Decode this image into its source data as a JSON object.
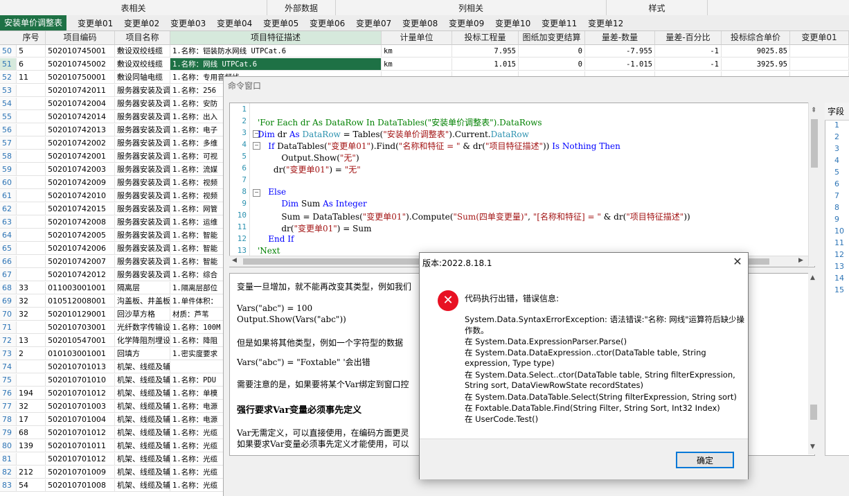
{
  "ribbon_groups": [
    "表相关",
    "外部数据",
    "列相关",
    "样式"
  ],
  "tabs": [
    "安装单价调整表",
    "变更单01",
    "变更单02",
    "变更单03",
    "变更单04",
    "变更单05",
    "变更单06",
    "变更单07",
    "变更单08",
    "变更单09",
    "变更单10",
    "变更单11",
    "变更单12"
  ],
  "columns": [
    "序号",
    "项目编码",
    "项目名称",
    "项目特征描述",
    "计量单位",
    "投标工程量",
    "图纸加变更结算",
    "量差-数量",
    "量差-百分比",
    "投标综合单价",
    "变更单01"
  ],
  "rows": [
    {
      "rn": "50",
      "seq": "5",
      "code": "502010745001",
      "name": "敷设双绞线缆",
      "desc": "1.名称：铠装防水网线 UTPCat.6",
      "unit": "km",
      "qty": "7.955",
      "settle": "0",
      "diff": "-7.955",
      "pct": "-1",
      "price": "9025.85"
    },
    {
      "rn": "51",
      "seq": "6",
      "code": "502010745002",
      "name": "敷设双绞线缆",
      "desc": "1.名称：网线 UTPCat.6",
      "unit": "km",
      "qty": "1.015",
      "settle": "0",
      "diff": "-1.015",
      "pct": "-1",
      "price": "3925.95"
    },
    {
      "rn": "52",
      "seq": "11",
      "code": "502010750001",
      "name": "敷设同轴电缆",
      "desc": "1.名称：专用音频线",
      "unit": "",
      "qty": "",
      "settle": "",
      "diff": "",
      "pct": "",
      "price": ""
    },
    {
      "rn": "53",
      "seq": "",
      "code": "502010742011",
      "name": "服务器安装及调",
      "desc": "1.名称：256",
      "unit": "",
      "qty": "",
      "settle": "",
      "diff": "",
      "pct": "",
      "price": ""
    },
    {
      "rn": "54",
      "seq": "",
      "code": "502010742004",
      "name": "服务器安装及调",
      "desc": "1.名称：安防",
      "unit": "",
      "qty": "",
      "settle": "",
      "diff": "",
      "pct": "",
      "price": ""
    },
    {
      "rn": "55",
      "seq": "",
      "code": "502010742014",
      "name": "服务器安装及调",
      "desc": "1.名称：出入",
      "unit": "",
      "qty": "",
      "settle": "",
      "diff": "",
      "pct": "",
      "price": ""
    },
    {
      "rn": "56",
      "seq": "",
      "code": "502010742013",
      "name": "服务器安装及调",
      "desc": "1.名称：电子",
      "unit": "",
      "qty": "",
      "settle": "",
      "diff": "",
      "pct": "",
      "price": ""
    },
    {
      "rn": "57",
      "seq": "",
      "code": "502010742002",
      "name": "服务器安装及调",
      "desc": "1.名称：多维",
      "unit": "",
      "qty": "",
      "settle": "",
      "diff": "",
      "pct": "",
      "price": ""
    },
    {
      "rn": "58",
      "seq": "",
      "code": "502010742001",
      "name": "服务器安装及调",
      "desc": "1.名称：可视",
      "unit": "",
      "qty": "",
      "settle": "",
      "diff": "",
      "pct": "",
      "price": ""
    },
    {
      "rn": "59",
      "seq": "",
      "code": "502010742003",
      "name": "服务器安装及调",
      "desc": "1.名称：流媒",
      "unit": "",
      "qty": "",
      "settle": "",
      "diff": "",
      "pct": "",
      "price": ""
    },
    {
      "rn": "60",
      "seq": "",
      "code": "502010742009",
      "name": "服务器安装及调",
      "desc": "1.名称：视频",
      "unit": "",
      "qty": "",
      "settle": "",
      "diff": "",
      "pct": "",
      "price": ""
    },
    {
      "rn": "61",
      "seq": "",
      "code": "502010742010",
      "name": "服务器安装及调",
      "desc": "1.名称：视频",
      "unit": "",
      "qty": "",
      "settle": "",
      "diff": "",
      "pct": "",
      "price": ""
    },
    {
      "rn": "62",
      "seq": "",
      "code": "502010742015",
      "name": "服务器安装及调",
      "desc": "1.名称：网管",
      "unit": "",
      "qty": "",
      "settle": "",
      "diff": "",
      "pct": "",
      "price": ""
    },
    {
      "rn": "63",
      "seq": "",
      "code": "502010742008",
      "name": "服务器安装及调",
      "desc": "1.名称：运维",
      "unit": "",
      "qty": "",
      "settle": "",
      "diff": "",
      "pct": "",
      "price": ""
    },
    {
      "rn": "64",
      "seq": "",
      "code": "502010742005",
      "name": "服务器安装及调",
      "desc": "1.名称：智能",
      "unit": "",
      "qty": "",
      "settle": "",
      "diff": "",
      "pct": "",
      "price": ""
    },
    {
      "rn": "65",
      "seq": "",
      "code": "502010742006",
      "name": "服务器安装及调",
      "desc": "1.名称：智能",
      "unit": "",
      "qty": "",
      "settle": "",
      "diff": "",
      "pct": "",
      "price": ""
    },
    {
      "rn": "66",
      "seq": "",
      "code": "502010742007",
      "name": "服务器安装及调",
      "desc": "1.名称：智能",
      "unit": "",
      "qty": "",
      "settle": "",
      "diff": "",
      "pct": "",
      "price": ""
    },
    {
      "rn": "67",
      "seq": "",
      "code": "502010742012",
      "name": "服务器安装及调",
      "desc": "1.名称：综合",
      "unit": "",
      "qty": "",
      "settle": "",
      "diff": "",
      "pct": "",
      "price": ""
    },
    {
      "rn": "68",
      "seq": "33",
      "code": "011003001001",
      "name": "隔离层",
      "desc": "1.隔离层部位",
      "unit": "",
      "qty": "",
      "settle": "",
      "diff": "",
      "pct": "",
      "price": ""
    },
    {
      "rn": "69",
      "seq": "32",
      "code": "010512008001",
      "name": "沟盖板、井盖板",
      "desc": "1.单件体积：",
      "unit": "",
      "qty": "",
      "settle": "",
      "diff": "",
      "pct": "",
      "price": ""
    },
    {
      "rn": "70",
      "seq": "32",
      "code": "502010129001",
      "name": "回沙草方格",
      "desc": "材质：芦苇",
      "unit": "",
      "qty": "",
      "settle": "",
      "diff": "",
      "pct": "",
      "price": ""
    },
    {
      "rn": "71",
      "seq": "",
      "code": "502010703001",
      "name": "光纤数字传输设",
      "desc": "1.名称：100M",
      "unit": "",
      "qty": "",
      "settle": "",
      "diff": "",
      "pct": "",
      "price": ""
    },
    {
      "rn": "72",
      "seq": "13",
      "code": "502010547001",
      "name": "化学降阻剂埋设",
      "desc": "1.名称：降阻",
      "unit": "",
      "qty": "",
      "settle": "",
      "diff": "",
      "pct": "",
      "price": ""
    },
    {
      "rn": "73",
      "seq": "2",
      "code": "010103001001",
      "name": "回填方",
      "desc": "1.密实度要求",
      "unit": "",
      "qty": "",
      "settle": "",
      "diff": "",
      "pct": "",
      "price": ""
    },
    {
      "rn": "74",
      "seq": "",
      "code": "502010701013",
      "name": "机架、线缆及辅",
      "desc": "",
      "unit": "",
      "qty": "",
      "settle": "",
      "diff": "",
      "pct": "",
      "price": ""
    },
    {
      "rn": "75",
      "seq": "",
      "code": "502010701010",
      "name": "机架、线缆及辅",
      "desc": "1.名称：PDU",
      "unit": "",
      "qty": "",
      "settle": "",
      "diff": "",
      "pct": "",
      "price": ""
    },
    {
      "rn": "76",
      "seq": "194",
      "code": "502010701012",
      "name": "机架、线缆及辅",
      "desc": "1.名称：单模",
      "unit": "",
      "qty": "",
      "settle": "",
      "diff": "",
      "pct": "",
      "price": ""
    },
    {
      "rn": "77",
      "seq": "32",
      "code": "502010701003",
      "name": "机架、线缆及辅",
      "desc": "1.名称：电源",
      "unit": "",
      "qty": "",
      "settle": "",
      "diff": "",
      "pct": "",
      "price": ""
    },
    {
      "rn": "78",
      "seq": "17",
      "code": "502010701004",
      "name": "机架、线缆及辅",
      "desc": "1.名称：电源",
      "unit": "",
      "qty": "",
      "settle": "",
      "diff": "",
      "pct": "",
      "price": ""
    },
    {
      "rn": "79",
      "seq": "68",
      "code": "502010701012",
      "name": "机架、线缆及辅",
      "desc": "1.名称：光缆",
      "unit": "",
      "qty": "",
      "settle": "",
      "diff": "",
      "pct": "",
      "price": ""
    },
    {
      "rn": "80",
      "seq": "139",
      "code": "502010701011",
      "name": "机架、线缆及辅",
      "desc": "1.名称：光缆",
      "unit": "",
      "qty": "",
      "settle": "",
      "diff": "",
      "pct": "",
      "price": ""
    },
    {
      "rn": "81",
      "seq": "",
      "code": "502010701012",
      "name": "机架、线缆及辅",
      "desc": "1.名称：光缆",
      "unit": "",
      "qty": "",
      "settle": "",
      "diff": "",
      "pct": "",
      "price": ""
    },
    {
      "rn": "82",
      "seq": "212",
      "code": "502010701009",
      "name": "机架、线缆及辅",
      "desc": "1.名称：光缆",
      "unit": "",
      "qty": "",
      "settle": "",
      "diff": "",
      "pct": "",
      "price": ""
    },
    {
      "rn": "83",
      "seq": "54",
      "code": "502010701008",
      "name": "机架、线缆及辅",
      "desc": "1.名称：光缆",
      "unit": "",
      "qty": "",
      "settle": "",
      "diff": "",
      "pct": "",
      "price": ""
    }
  ],
  "command_window": {
    "title": "命令窗口",
    "code_lines": [
      [
        {
          "t": "",
          "k": ""
        }
      ],
      [
        {
          "t": "'For Each dr As DataRow In DataTables(\"安装单价调整表\").DataRows",
          "k": "cm"
        }
      ],
      [
        {
          "t": "Dim",
          "k": "kw"
        },
        {
          "t": " dr ",
          "k": ""
        },
        {
          "t": "As",
          "k": "kw"
        },
        {
          "t": " ",
          "k": ""
        },
        {
          "t": "DataRow",
          "k": "typ"
        },
        {
          "t": " = Tables(",
          "k": ""
        },
        {
          "t": "\"安装单价调整表\"",
          "k": "str"
        },
        {
          "t": ").Current.",
          "k": ""
        },
        {
          "t": "DataRow",
          "k": "typ"
        }
      ],
      [
        {
          "t": "    If",
          "k": "kw"
        },
        {
          "t": " DataTables(",
          "k": ""
        },
        {
          "t": "\"变更单01\"",
          "k": "str"
        },
        {
          "t": ").Find(",
          "k": ""
        },
        {
          "t": "\"名称和特征 = \"",
          "k": "str"
        },
        {
          "t": " & dr(",
          "k": ""
        },
        {
          "t": "\"项目特征描述\"",
          "k": "str"
        },
        {
          "t": ")) ",
          "k": ""
        },
        {
          "t": "Is Nothing Then",
          "k": "kw"
        }
      ],
      [
        {
          "t": "         Output.Show(",
          "k": ""
        },
        {
          "t": "\"无\"",
          "k": "str"
        },
        {
          "t": ")",
          "k": ""
        }
      ],
      [
        {
          "t": "      dr(",
          "k": ""
        },
        {
          "t": "\"变更单01\"",
          "k": "str"
        },
        {
          "t": ") = ",
          "k": ""
        },
        {
          "t": "\"无\"",
          "k": "str"
        }
      ],
      [
        {
          "t": "",
          "k": ""
        }
      ],
      [
        {
          "t": "    Else",
          "k": "kw"
        }
      ],
      [
        {
          "t": "         Dim",
          "k": "kw"
        },
        {
          "t": " Sum ",
          "k": ""
        },
        {
          "t": "As Integer",
          "k": "kw"
        }
      ],
      [
        {
          "t": "         Sum = DataTables(",
          "k": ""
        },
        {
          "t": "\"变更单01\"",
          "k": "str"
        },
        {
          "t": ").Compute(",
          "k": ""
        },
        {
          "t": "\"Sum(四单变更量)\"",
          "k": "str"
        },
        {
          "t": ", ",
          "k": ""
        },
        {
          "t": "\"[名称和特征] = \"",
          "k": "str"
        },
        {
          "t": " & dr(",
          "k": ""
        },
        {
          "t": "\"项目特征描述\"",
          "k": "str"
        },
        {
          "t": "))",
          "k": ""
        }
      ],
      [
        {
          "t": "         dr(",
          "k": ""
        },
        {
          "t": "\"变更单01\"",
          "k": "str"
        },
        {
          "t": ") = Sum",
          "k": ""
        }
      ],
      [
        {
          "t": "    End If",
          "k": "kw"
        }
      ],
      [
        {
          "t": "'Next",
          "k": "cm"
        }
      ]
    ],
    "help_lines": [
      {
        "t": "变量一旦增加，就不能再改变其类型，例如我们",
        "b": false
      },
      {
        "t": "Vars(\"abc\") = 100",
        "b": false
      },
      {
        "t": "Output.Show(Vars(\"abc\"))",
        "b": false
      },
      {
        "t": "但是如果将其他类型，例如一个字符型的数据",
        "b": false
      },
      {
        "t": "Vars(\"abc\") = \"Foxtable\" '会出错",
        "b": false
      },
      {
        "t": "需要注意的是，如果要将某个Var绑定到窗口控",
        "b": false
      },
      {
        "t": "强行要求Var变量必须事先定义",
        "b": true
      },
      {
        "t": "Var无需定义，可以直接使用，在编码方面更灵",
        "b": false
      },
      {
        "t": "如果要求Var变量必须事先定义才能使用，可以",
        "b": false
      }
    ],
    "field_panel_label": "字段",
    "field_numbers": [
      "1",
      "2",
      "3",
      "4",
      "5",
      "6",
      "7",
      "8",
      "9",
      "10",
      "11",
      "12",
      "13",
      "14",
      "15"
    ]
  },
  "dialog": {
    "title": "版本:2022.8.18.1",
    "heading": "代码执行出错，错误信息:",
    "lines": [
      "System.Data.SyntaxErrorException: 语法错误:\"名称: 网线\"运算符后缺少操",
      "作数。",
      "   在 System.Data.ExpressionParser.Parse()",
      "   在 System.Data.DataExpression..ctor(DataTable table, String",
      "expression, Type type)",
      "   在 System.Data.Select..ctor(DataTable table, String filterExpression,",
      "String sort, DataViewRowState recordStates)",
      "   在 System.Data.DataTable.Select(String filterExpression, String sort)",
      "   在 Foxtable.DataTable.Find(String Filter, String Sort, Int32 Index)",
      "   在 UserCode.Test()"
    ],
    "ok_label": "确定"
  }
}
